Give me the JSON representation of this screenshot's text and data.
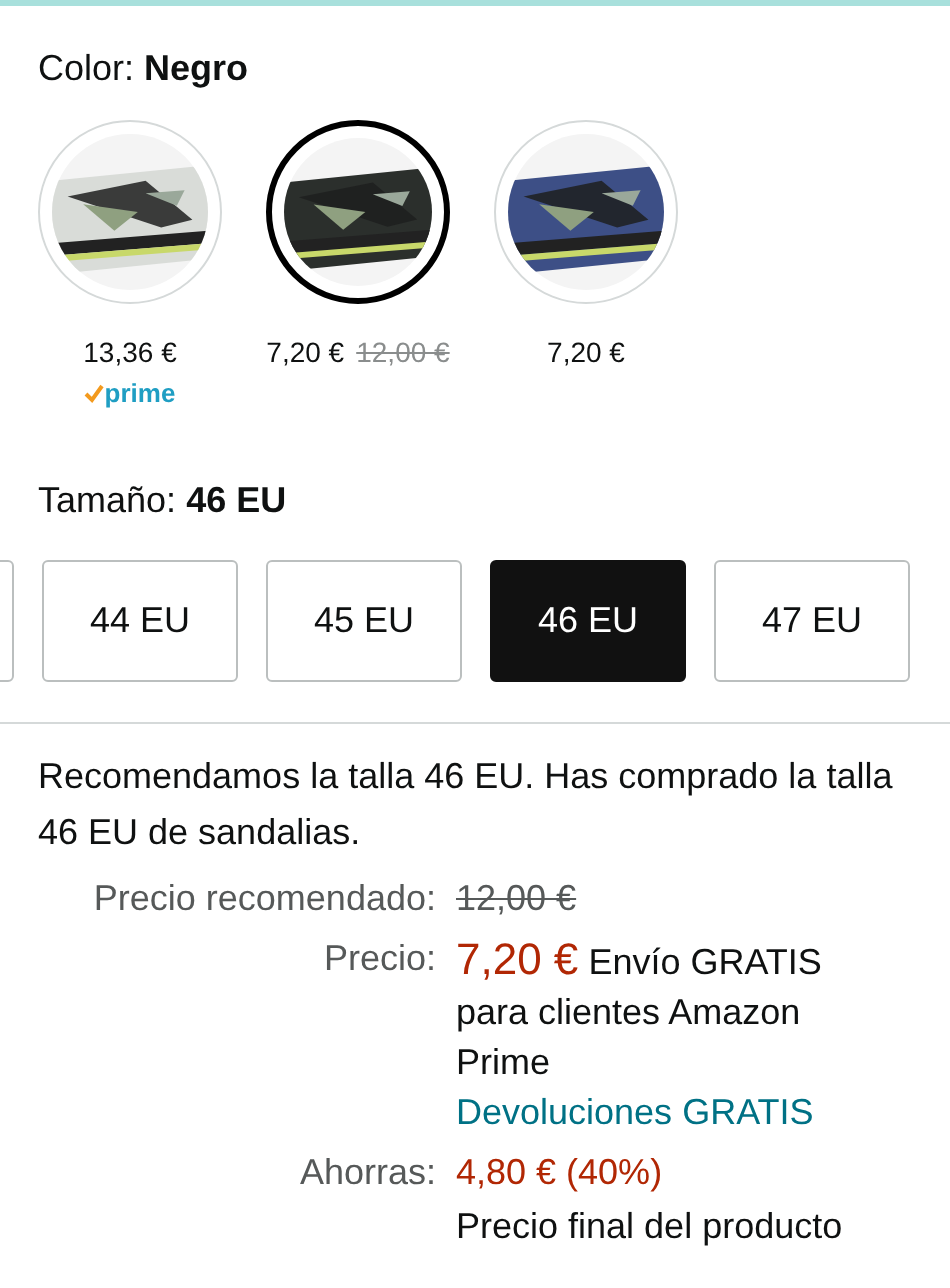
{
  "color": {
    "label": "Color:",
    "value": "Negro"
  },
  "swatches": [
    {
      "selected": false,
      "price": "13,36 €",
      "prime": true,
      "prime_label": "prime"
    },
    {
      "selected": true,
      "price": "7,20 €",
      "list_price": "12,00 €",
      "prime": false
    },
    {
      "selected": false,
      "price": "7,20 €",
      "prime": false
    }
  ],
  "size": {
    "label": "Tamaño:",
    "value": "46 EU"
  },
  "sizes": [
    {
      "label": "44 EU",
      "selected": false
    },
    {
      "label": "45 EU",
      "selected": false
    },
    {
      "label": "46 EU",
      "selected": true
    },
    {
      "label": "47 EU",
      "selected": false
    }
  ],
  "recommendation": "Recomendamos la talla 46 EU. Has comprado la talla 46 EU de sandalias.",
  "price_rows": [
    {
      "kind": "list",
      "label": "Precio recomendado:",
      "value": "12,00 €"
    },
    {
      "kind": "price",
      "label": "Precio:",
      "value": "7,20 €",
      "note": "Envío GRATIS para clientes Amazon Prime",
      "link": "Devoluciones GRATIS"
    },
    {
      "kind": "savings",
      "label": "Ahorras:",
      "value": "4,80 € (40%)",
      "note": "Precio final del producto"
    }
  ]
}
